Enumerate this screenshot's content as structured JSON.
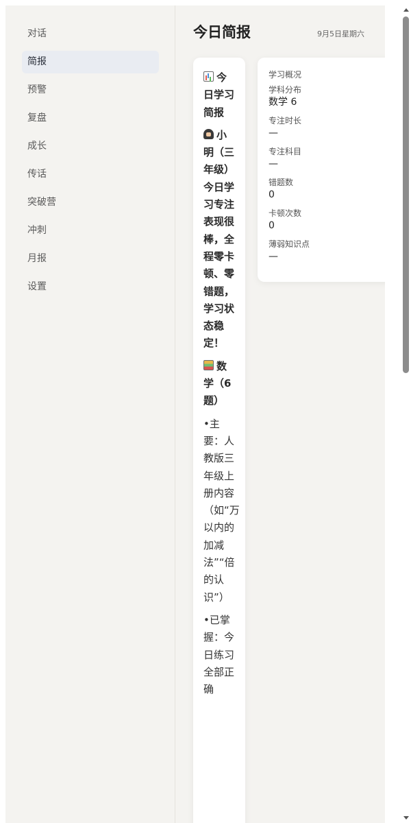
{
  "sidebar": {
    "items": [
      {
        "label": "对话",
        "active": false
      },
      {
        "label": "简报",
        "active": true
      },
      {
        "label": "预警",
        "active": false
      },
      {
        "label": "复盘",
        "active": false
      },
      {
        "label": "成长",
        "active": false
      },
      {
        "label": "传话",
        "active": false
      },
      {
        "label": "突破营",
        "active": false
      },
      {
        "label": "冲刺",
        "active": false
      },
      {
        "label": "月报",
        "active": false
      },
      {
        "label": "设置",
        "active": false
      }
    ]
  },
  "header": {
    "title": "今日简报",
    "date": "9月5日星期六"
  },
  "brief": {
    "heading_icon": "bar-chart-icon",
    "heading": "今日学习简报",
    "summary_icon": "student-icon",
    "summary": "小明（三年级）今日学习专注表现很棒，全程零卡顿、零错题，学习状态稳定！",
    "subject_icon": "books-icon",
    "subject": "数学（6题）",
    "point_main": "•主要：人教版三年级上册内容（如“万以内的加减法”“倍的认识”）",
    "point_mastered": "•已掌握：今日练习全部正确"
  },
  "overview": {
    "title": "学习概况",
    "items": [
      {
        "label": "学科分布",
        "value": "数学 6"
      },
      {
        "label": "专注时长",
        "value": "—"
      },
      {
        "label": "专注科目",
        "value": "—"
      },
      {
        "label": "错题数",
        "value": "0"
      },
      {
        "label": "卡顿次数",
        "value": "0"
      },
      {
        "label": "薄弱知识点",
        "value": "—"
      }
    ]
  },
  "colors": {
    "app_background": "#f4f3f0",
    "active_nav": "#e9ecf2",
    "card": "#ffffff"
  }
}
